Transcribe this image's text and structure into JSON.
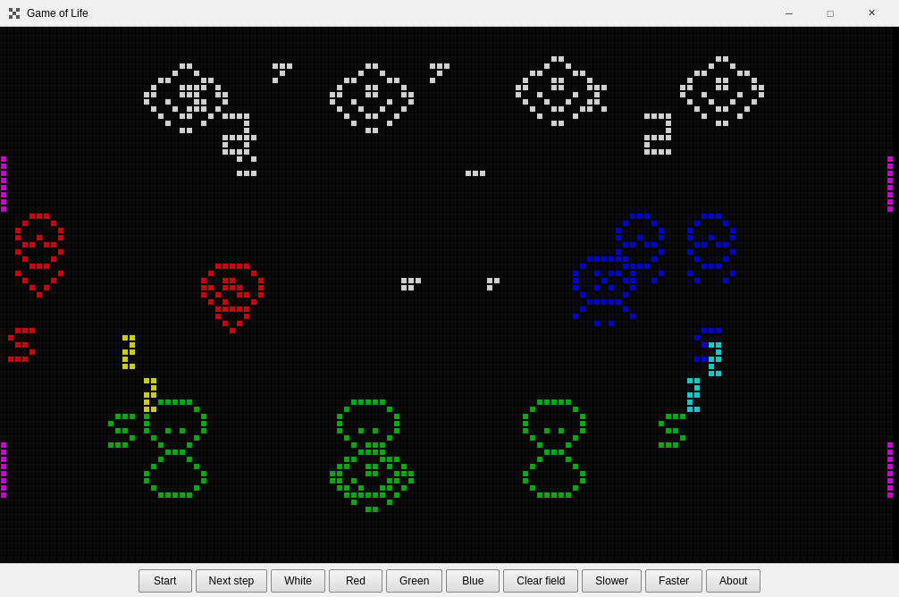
{
  "titleBar": {
    "title": "Game of Life",
    "minimizeLabel": "─",
    "maximizeLabel": "□",
    "closeLabel": "✕"
  },
  "toolbar": {
    "buttons": [
      {
        "id": "start",
        "label": "Start"
      },
      {
        "id": "next-step",
        "label": "Next step"
      },
      {
        "id": "white",
        "label": "White"
      },
      {
        "id": "red",
        "label": "Red"
      },
      {
        "id": "green",
        "label": "Green"
      },
      {
        "id": "blue",
        "label": "Blue"
      },
      {
        "id": "clear-field",
        "label": "Clear field"
      },
      {
        "id": "slower",
        "label": "Slower"
      },
      {
        "id": "faster",
        "label": "Faster"
      },
      {
        "id": "about",
        "label": "About"
      }
    ]
  },
  "canvas": {
    "cellSize": 8,
    "colors": {
      "dead": "#000000",
      "white": "#d0d0d0",
      "red": "#cc0000",
      "green": "#00aa00",
      "blue": "#0000cc",
      "yellow": "#cccc00",
      "cyan": "#00cccc",
      "magenta": "#cc00cc"
    }
  }
}
